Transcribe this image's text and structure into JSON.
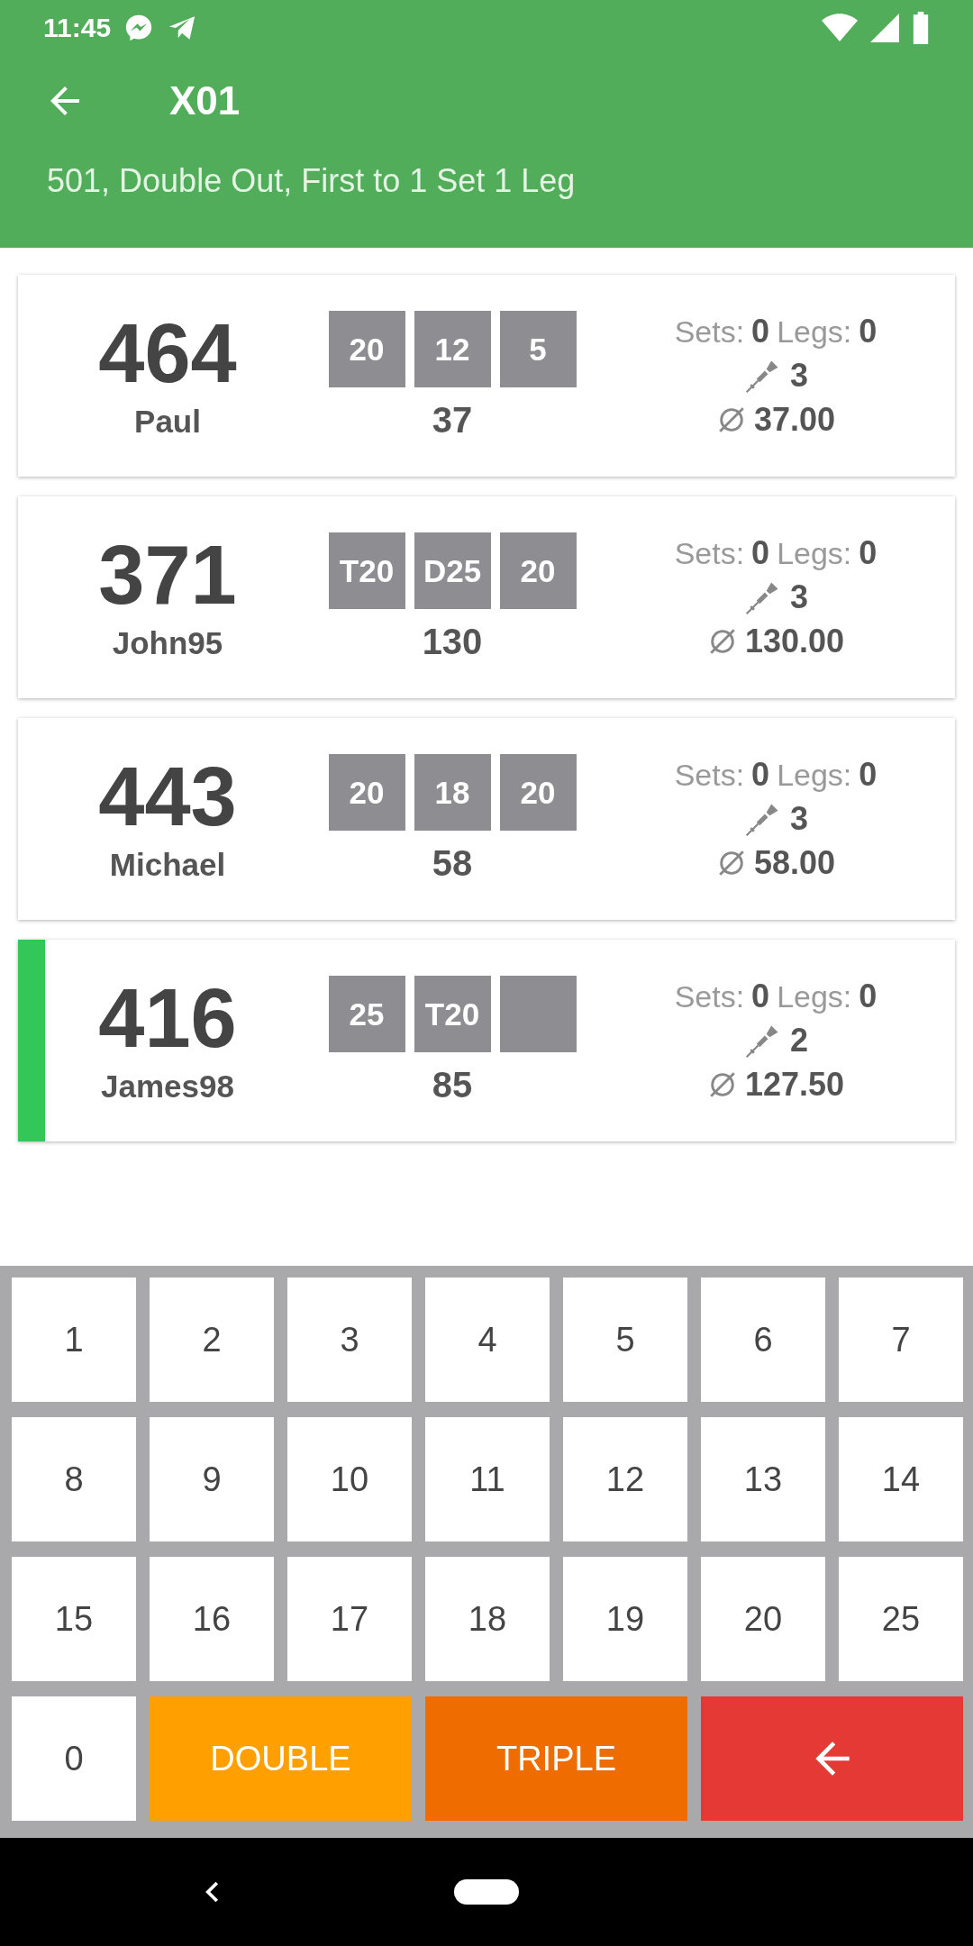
{
  "status_bar": {
    "time": "11:45"
  },
  "app_bar": {
    "title": "X01",
    "subtitle": "501, Double Out, First to 1 Set 1 Leg"
  },
  "players": [
    {
      "score": "464",
      "name": "Paul",
      "throws": [
        "20",
        "12",
        "5"
      ],
      "turn_total": "37",
      "sets_label": "Sets:",
      "sets": "0",
      "legs_label": "Legs:",
      "legs": "0",
      "darts": "3",
      "average": "37.00",
      "active": false
    },
    {
      "score": "371",
      "name": "John95",
      "throws": [
        "T20",
        "D25",
        "20"
      ],
      "turn_total": "130",
      "sets_label": "Sets:",
      "sets": "0",
      "legs_label": "Legs:",
      "legs": "0",
      "darts": "3",
      "average": "130.00",
      "active": false
    },
    {
      "score": "443",
      "name": "Michael",
      "throws": [
        "20",
        "18",
        "20"
      ],
      "turn_total": "58",
      "sets_label": "Sets:",
      "sets": "0",
      "legs_label": "Legs:",
      "legs": "0",
      "darts": "3",
      "average": "58.00",
      "active": false
    },
    {
      "score": "416",
      "name": "James98",
      "throws": [
        "25",
        "T20"
      ],
      "turn_total": "85",
      "sets_label": "Sets:",
      "sets": "0",
      "legs_label": "Legs:",
      "legs": "0",
      "darts": "2",
      "average": "127.50",
      "active": true
    }
  ],
  "keypad": {
    "numbers": [
      "1",
      "2",
      "3",
      "4",
      "5",
      "6",
      "7",
      "8",
      "9",
      "10",
      "11",
      "12",
      "13",
      "14",
      "15",
      "16",
      "17",
      "18",
      "19",
      "20",
      "25",
      "0"
    ],
    "actions": [
      {
        "kind": "double",
        "label": "DOUBLE"
      },
      {
        "kind": "triple",
        "label": "TRIPLE"
      },
      {
        "kind": "backspace"
      }
    ]
  }
}
